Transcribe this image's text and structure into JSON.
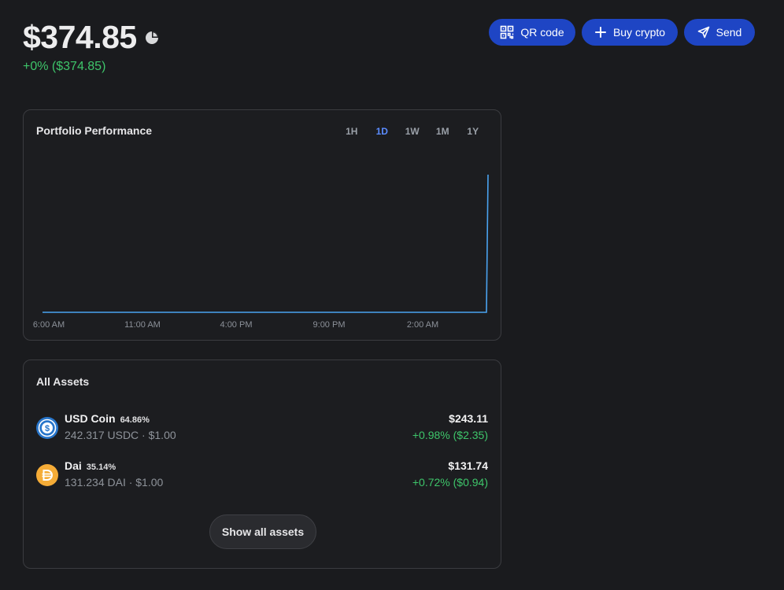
{
  "header": {
    "balance": "$374.85",
    "change": "+0% ($374.85)",
    "balance_icon": "pie-chart-icon"
  },
  "actions": {
    "qr_label": "QR code",
    "qr_icon": "qr-code-icon",
    "buy_label": "Buy crypto",
    "buy_icon": "plus-icon",
    "send_label": "Send",
    "send_icon": "send-icon"
  },
  "performance": {
    "title": "Portfolio Performance",
    "ranges": [
      "1H",
      "1D",
      "1W",
      "1M",
      "1Y"
    ],
    "active_range": "1D"
  },
  "chart_data": {
    "type": "line",
    "title": "Portfolio Performance",
    "x_ticks": [
      "6:00 AM",
      "11:00 AM",
      "4:00 PM",
      "9:00 PM",
      "2:00 AM"
    ],
    "series": [
      {
        "values": [
          0,
          0,
          0,
          0,
          0,
          0,
          0,
          0,
          0,
          0,
          0,
          0,
          0,
          0,
          0,
          0,
          0,
          0,
          0,
          0,
          0,
          0,
          0,
          0,
          374.85
        ]
      }
    ],
    "ylim": [
      0,
      374.85
    ],
    "grid": false,
    "line_color": "#4aa3f0"
  },
  "assets": {
    "title": "All Assets",
    "items": [
      {
        "name": "USD Coin",
        "pct": "64.86%",
        "sub": "242.317 USDC · $1.00",
        "value": "$243.11",
        "change": "+0.98% ($2.35)",
        "icon": "usdc-icon",
        "color": "#2775ca"
      },
      {
        "name": "Dai",
        "pct": "35.14%",
        "sub": "131.234 DAI · $1.00",
        "value": "$131.74",
        "change": "+0.72% ($0.94)",
        "icon": "dai-icon",
        "color": "#f5ac37"
      }
    ],
    "show_all_label": "Show all assets"
  },
  "colors": {
    "background": "#1a1b1e",
    "accent": "#1e45c4",
    "positive": "#3ec56a",
    "active_range": "#5b8cff"
  }
}
